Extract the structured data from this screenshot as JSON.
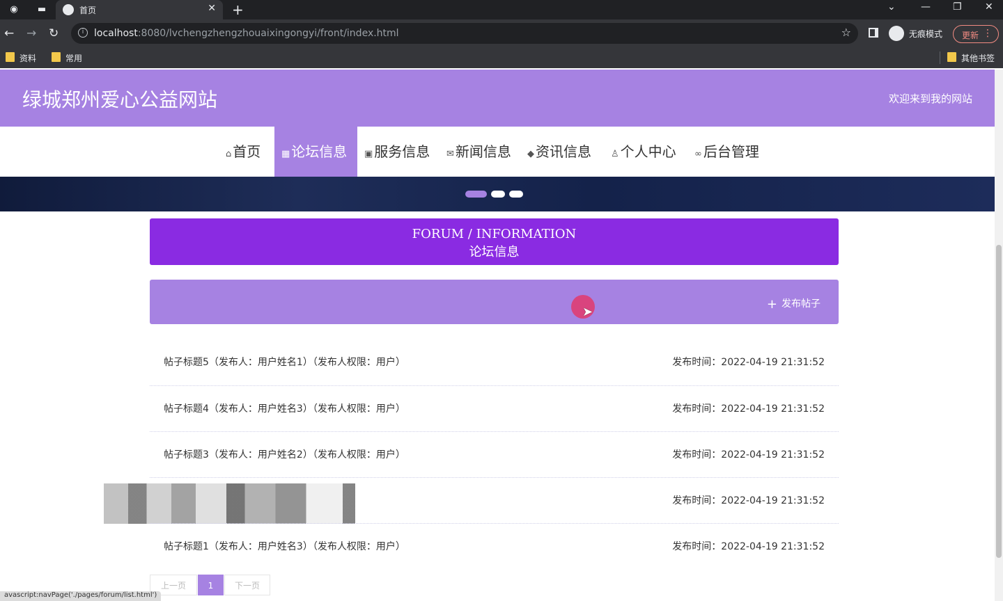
{
  "browser": {
    "tab_title": "首页",
    "new_tab": "+",
    "tab_close": "✕",
    "url_host": "localhost",
    "url_rest": ":8080/lvchengzhengzhouaixingongyi/front/index.html",
    "incognito_label": "无痕模式",
    "update_label": "更新",
    "bookmarks": [
      "资料",
      "常用"
    ],
    "other_bookmarks": "其他书签"
  },
  "site": {
    "title": "绿城郑州爱心公益网站",
    "welcome": "欢迎来到我的网站"
  },
  "nav": {
    "items": [
      {
        "icon": "home-icon",
        "glyph": "⌂",
        "label": "首页"
      },
      {
        "icon": "forum-icon",
        "glyph": "▦",
        "label": "论坛信息"
      },
      {
        "icon": "grid-icon",
        "glyph": "▣",
        "label": "服务信息"
      },
      {
        "icon": "mail-icon",
        "glyph": "✉",
        "label": "新闻信息"
      },
      {
        "icon": "layers-icon",
        "glyph": "◆",
        "label": "资讯信息"
      },
      {
        "icon": "user-icon",
        "glyph": "♙",
        "label": "个人中心"
      },
      {
        "icon": "link-icon",
        "glyph": "∞",
        "label": "后台管理"
      }
    ],
    "active": "论坛信息"
  },
  "banner": {
    "active_slide": 1,
    "slide_count": 3
  },
  "forum": {
    "heading_en": "FORUM / INFORMATION",
    "heading_cn": "论坛信息",
    "post_button": "发布帖子"
  },
  "posts": [
    {
      "title": "帖子标题5（发布人：用户姓名1）（发布人权限：用户）",
      "time": "发布时间：2022-04-19 21:31:52"
    },
    {
      "title": "帖子标题4（发布人：用户姓名3）（发布人权限：用户）",
      "time": "发布时间：2022-04-19 21:31:52"
    },
    {
      "title": "帖子标题3（发布人：用户姓名2）（发布人权限：用户）",
      "time": "发布时间：2022-04-19 21:31:52"
    },
    {
      "title": "",
      "time": "发布时间：2022-04-19 21:31:52"
    },
    {
      "title": "帖子标题1（发布人：用户姓名3）（发布人权限：用户）",
      "time": "发布时间：2022-04-19 21:31:52"
    }
  ],
  "pager": {
    "prev": "上一页",
    "current": "1",
    "next": "下一页"
  },
  "status_bar": "avascript:navPage('./pages/forum/list.html')",
  "colors": {
    "header_purple": "#a682e2",
    "forum_heading": "#8a2be2"
  }
}
